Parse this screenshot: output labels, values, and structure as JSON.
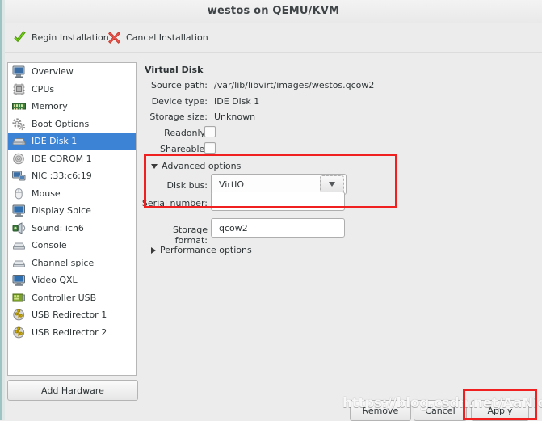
{
  "window": {
    "title": "westos on QEMU/KVM"
  },
  "toolbar": {
    "begin_label": "Begin Installation",
    "begin_icon": "green-check-icon",
    "cancel_label": "Cancel Installation",
    "cancel_icon": "red-x-icon"
  },
  "sidebar": {
    "items": [
      {
        "label": "Overview",
        "icon": "computer-icon",
        "selected": false
      },
      {
        "label": "CPUs",
        "icon": "cpu-chip-icon",
        "selected": false
      },
      {
        "label": "Memory",
        "icon": "memory-ram-icon",
        "selected": false
      },
      {
        "label": "Boot Options",
        "icon": "gears-icon",
        "selected": false
      },
      {
        "label": "IDE Disk 1",
        "icon": "harddisk-icon",
        "selected": true
      },
      {
        "label": "IDE CDROM 1",
        "icon": "optical-disc-icon",
        "selected": false
      },
      {
        "label": "NIC :33:c6:19",
        "icon": "network-card-icon",
        "selected": false
      },
      {
        "label": "Mouse",
        "icon": "mouse-icon",
        "selected": false
      },
      {
        "label": "Display Spice",
        "icon": "display-monitor-icon",
        "selected": false
      },
      {
        "label": "Sound: ich6",
        "icon": "speaker-icon",
        "selected": false
      },
      {
        "label": "Console",
        "icon": "console-icon",
        "selected": false
      },
      {
        "label": "Channel spice",
        "icon": "channel-icon",
        "selected": false
      },
      {
        "label": "Video QXL",
        "icon": "video-monitor-icon",
        "selected": false
      },
      {
        "label": "Controller USB",
        "icon": "controller-card-icon",
        "selected": false
      },
      {
        "label": "USB Redirector 1",
        "icon": "usb-icon",
        "selected": false
      },
      {
        "label": "USB Redirector 2",
        "icon": "usb-icon",
        "selected": false
      }
    ],
    "add_hardware_label": "Add Hardware"
  },
  "main": {
    "section_title": "Virtual Disk",
    "fields": {
      "source_path_label": "Source path:",
      "source_path_value": "/var/lib/libvirt/images/westos.qcow2",
      "device_type_label": "Device type:",
      "device_type_value": "IDE Disk 1",
      "storage_size_label": "Storage size:",
      "storage_size_value": "Unknown",
      "readonly_label": "Readonly:",
      "readonly_checked": false,
      "shareable_label": "Shareable:",
      "shareable_checked": false
    },
    "advanced": {
      "toggle_label": "Advanced options",
      "expanded": true,
      "disk_bus_label": "Disk bus:",
      "disk_bus_value": "VirtIO",
      "serial_number_label": "Serial number:",
      "serial_number_value": ""
    },
    "storage_format_label": "Storage format:",
    "storage_format_value": "qcow2",
    "performance": {
      "toggle_label": "Performance options",
      "expanded": false
    }
  },
  "footer": {
    "remove_label": "Remove",
    "cancel_label": "Cancel",
    "apply_label": "Apply"
  },
  "overlay": {
    "watermark_text": "https://blog.csdn.net/AaNiceMan",
    "highlight_color": "#f02020",
    "accent_color": "#3c83d6"
  }
}
